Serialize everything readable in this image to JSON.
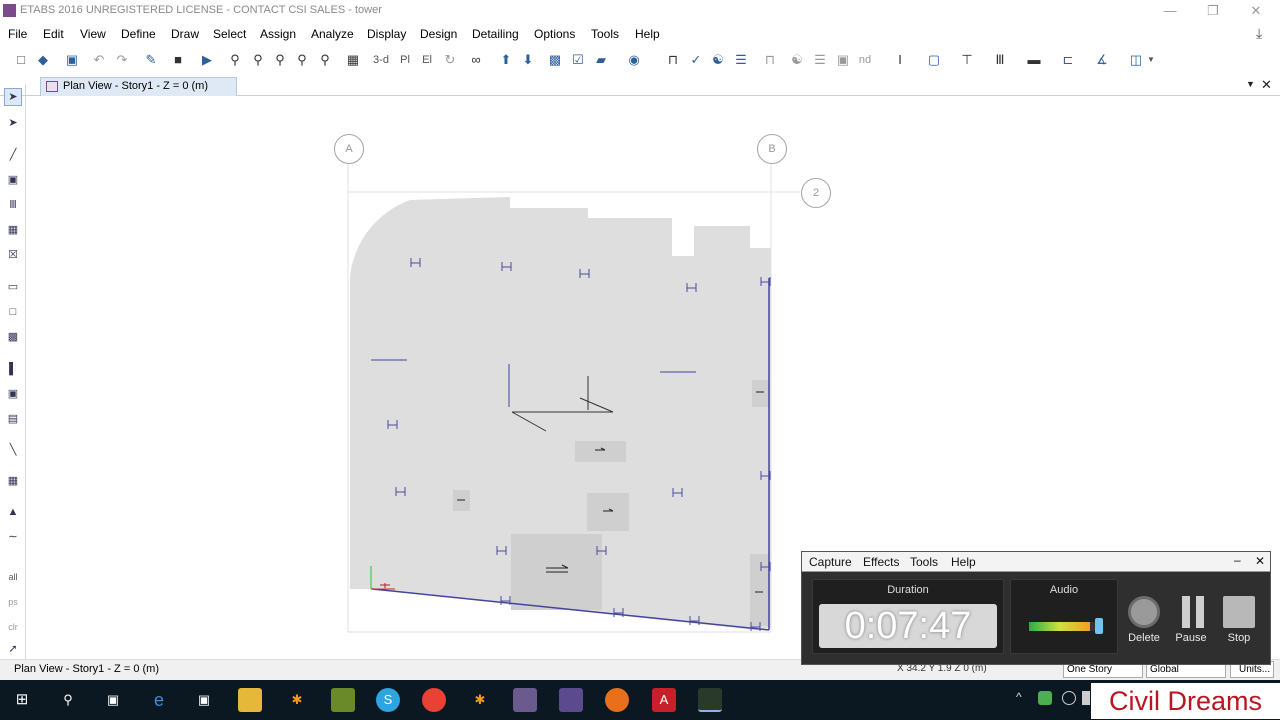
{
  "window": {
    "title": "ETABS 2016 UNREGISTERED LICENSE - CONTACT CSI SALES - tower"
  },
  "menu": [
    "File",
    "Edit",
    "View",
    "Define",
    "Draw",
    "Select",
    "Assign",
    "Analyze",
    "Display",
    "Design",
    "Detailing",
    "Options",
    "Tools",
    "Help"
  ],
  "toolbar": {
    "view_3d_label": "3-d",
    "view_plan_label": "Pl",
    "view_elev_label": "El",
    "nd_label": "nd"
  },
  "tab": {
    "label": "Plan View - Story1 - Z = 0 (m)"
  },
  "grid_bubbles": {
    "a": "A",
    "b": "B",
    "row2": "2"
  },
  "side_labels": {
    "all": "all",
    "ps": "ps",
    "clr": "clr"
  },
  "status": {
    "left": "Plan View - Story1 - Z = 0 (m)",
    "coords": "X 34.2  Y 1.9  Z 0 (m)",
    "story_select": "One Story",
    "coord_system": "Global",
    "units": "Units..."
  },
  "recorder": {
    "menu": [
      "Capture",
      "Effects",
      "Tools",
      "Help"
    ],
    "duration_label": "Duration",
    "duration_value": "0:07:47",
    "audio_label": "Audio",
    "audio_level": 0.85,
    "delete_label": "Delete",
    "pause_label": "Pause",
    "stop_label": "Stop"
  },
  "brand": "Civil Dreams",
  "colors": {
    "slab": "#dedede",
    "beam": "#3b3b8f",
    "taskbar": "#0b1822",
    "brand_red": "#b81620"
  }
}
